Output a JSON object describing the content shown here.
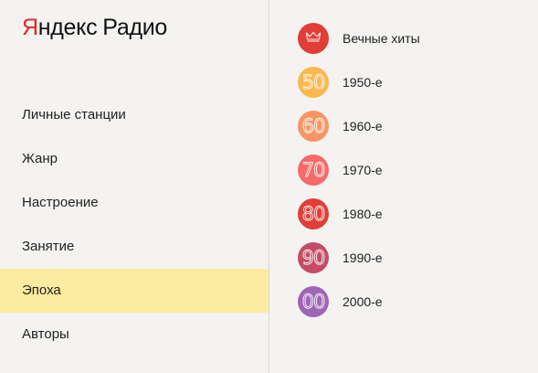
{
  "logo": {
    "brand_first": "Я",
    "brand_rest": "ндекс",
    "product": "Радио"
  },
  "nav": {
    "items": [
      {
        "label": "Личные станции",
        "active": false
      },
      {
        "label": "Жанр",
        "active": false
      },
      {
        "label": "Настроение",
        "active": false
      },
      {
        "label": "Занятие",
        "active": false
      },
      {
        "label": "Эпоха",
        "active": true
      },
      {
        "label": "Авторы",
        "active": false
      }
    ]
  },
  "stations": [
    {
      "label": "Вечные хиты",
      "icon": "crown-icon",
      "color": "#e03e36"
    },
    {
      "label": "1950-е",
      "badge": "50",
      "color": "#fbb84f"
    },
    {
      "label": "1960-е",
      "badge": "60",
      "color": "#f89663"
    },
    {
      "label": "1970-е",
      "badge": "70",
      "color": "#f46b6a"
    },
    {
      "label": "1980-е",
      "badge": "80",
      "color": "#e03e36"
    },
    {
      "label": "1990-е",
      "badge": "90",
      "color": "#c44d66"
    },
    {
      "label": "2000-е",
      "badge": "00",
      "color": "#a065b5"
    }
  ],
  "colors": {
    "background": "#f4f3f1",
    "active_item": "#fcec9f",
    "brand_red": "#e52620"
  }
}
